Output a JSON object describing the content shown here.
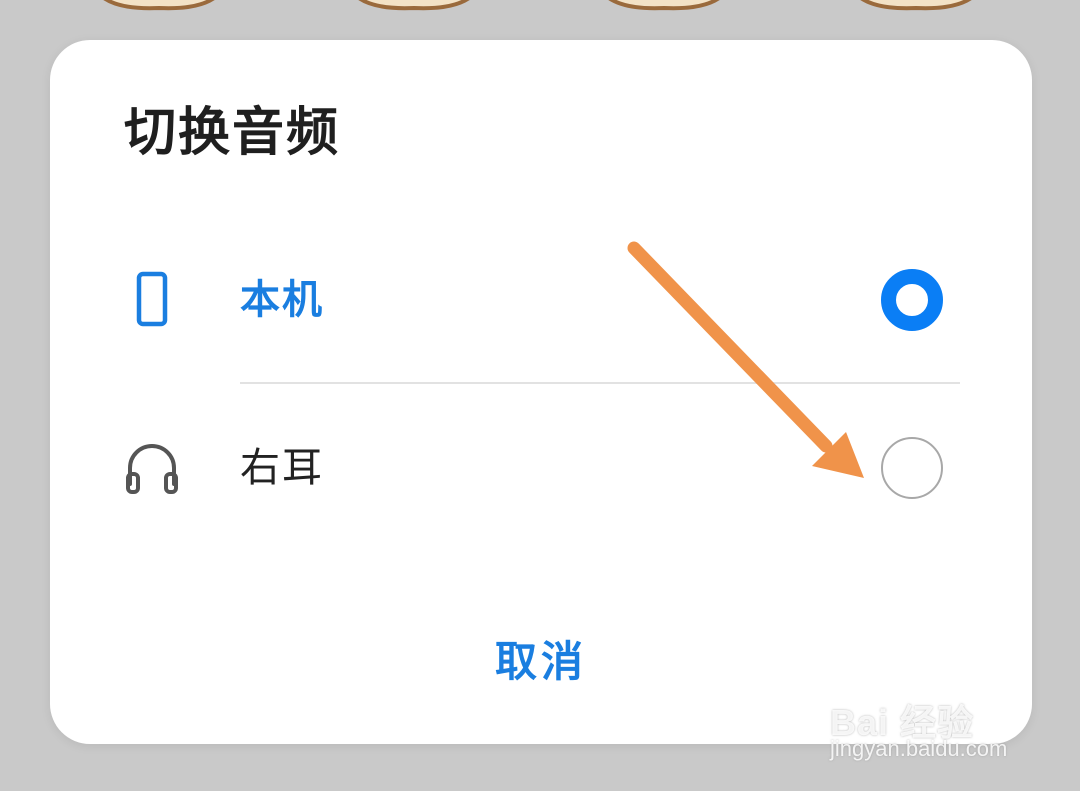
{
  "dialog": {
    "title": "切换音频",
    "options": [
      {
        "label": "本机",
        "icon": "phone-icon",
        "selected": true
      },
      {
        "label": "右耳",
        "icon": "headphones-icon",
        "selected": false
      }
    ],
    "cancel_label": "取消"
  },
  "colors": {
    "accent": "#0a7ef5",
    "accent_text": "#1a7ee0",
    "arrow": "#f0934a",
    "backdrop": "#c9c9c9"
  },
  "watermark": {
    "brand": "Bai  经验",
    "url": "jingyan.baidu.com"
  }
}
